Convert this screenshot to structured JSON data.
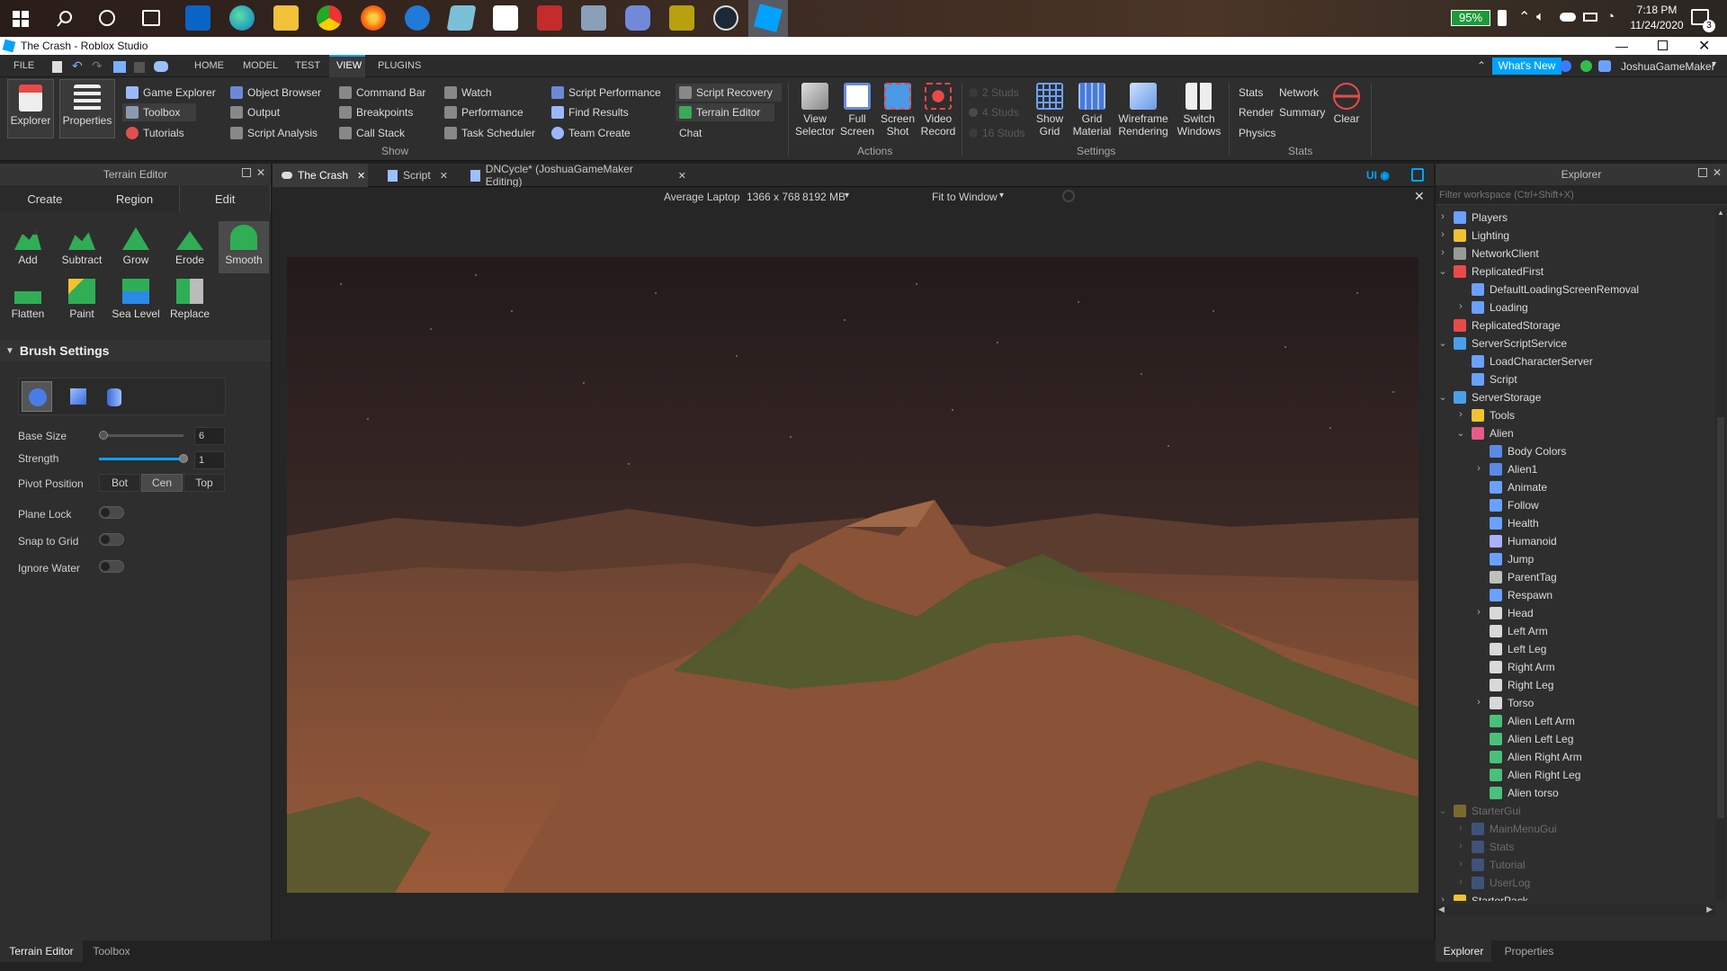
{
  "taskbar": {
    "battery": "95%",
    "time": "7:18 PM",
    "date": "11/24/2020",
    "notifications": "3"
  },
  "window": {
    "title": "The Crash - Roblox Studio",
    "user": "JoshuaGameMaker",
    "whats_new": "What's New"
  },
  "menubar": {
    "items": [
      "FILE",
      "HOME",
      "MODEL",
      "TEST",
      "VIEW",
      "PLUGINS"
    ]
  },
  "ribbon": {
    "explorer": "Explorer",
    "properties": "Properties",
    "show_col1": [
      "Game Explorer",
      "Toolbox",
      "Tutorials"
    ],
    "show_col2": [
      "Object Browser",
      "Output",
      "Script Analysis"
    ],
    "show_col3": [
      "Command Bar",
      "Breakpoints",
      "Call Stack"
    ],
    "show_col4": [
      "Watch",
      "Performance",
      "Task Scheduler"
    ],
    "show_col5": [
      "Script Performance",
      "Find Results",
      "Team Create"
    ],
    "show_col6": [
      "Script Recovery",
      "Terrain Editor",
      "Chat"
    ],
    "show_label": "Show",
    "actions": {
      "view_selector": [
        "View",
        "Selector"
      ],
      "full_screen": [
        "Full",
        "Screen"
      ],
      "screen_shot": [
        "Screen",
        "Shot"
      ],
      "video_record": [
        "Video",
        "Record"
      ],
      "label": "Actions"
    },
    "studs": [
      "2 Studs",
      "4 Studs",
      "16 Studs"
    ],
    "settings": {
      "show_grid": [
        "Show",
        "Grid"
      ],
      "grid_material": [
        "Grid",
        "Material"
      ],
      "wireframe": [
        "Wireframe",
        "Rendering"
      ],
      "switch_windows": [
        "Switch",
        "Windows"
      ],
      "label": "Settings"
    },
    "stats": {
      "col1": [
        "Stats",
        "Render",
        "Physics"
      ],
      "col2": [
        "Network",
        "Summary"
      ],
      "clear": "Clear",
      "label": "Stats"
    },
    "accent": "#00a2ff"
  },
  "terrain_editor": {
    "title": "Terrain Editor",
    "tabs": [
      "Create",
      "Region",
      "Edit"
    ],
    "tools_row1": [
      "Add",
      "Subtract",
      "Grow",
      "Erode",
      "Smooth"
    ],
    "tools_row2": [
      "Flatten",
      "Paint",
      "Sea Level",
      "Replace"
    ],
    "brush_settings": "Brush Settings",
    "base_size_label": "Base Size",
    "base_size_value": "6",
    "strength_label": "Strength",
    "strength_value": "1",
    "base_size_fraction": 0.05,
    "strength_fraction": 1.0,
    "pivot_label": "Pivot Position",
    "pivot_options": [
      "Bot",
      "Cen",
      "Top"
    ],
    "plane_lock": "Plane Lock",
    "snap_to_grid": "Snap to Grid",
    "ignore_water": "Ignore Water"
  },
  "doc_tabs": [
    "The Crash",
    "Script",
    "DNCycle* (JoshuaGameMaker Editing)"
  ],
  "emulator": {
    "device": "Average Laptop",
    "resolution": "1366 x 768",
    "memory": "8192 MB",
    "fit": "Fit to Window",
    "ui_label": "UI"
  },
  "explorer": {
    "title": "Explorer",
    "filter_placeholder": "Filter workspace (Ctrl+Shift+X)",
    "items": [
      {
        "label": "Players",
        "depth": 0,
        "chev": ">",
        "icon": "#6aa0ff"
      },
      {
        "label": "Lighting",
        "depth": 0,
        "chev": ">",
        "icon": "#f2c230"
      },
      {
        "label": "NetworkClient",
        "depth": 0,
        "chev": ">",
        "icon": "#9a9a9a"
      },
      {
        "label": "ReplicatedFirst",
        "depth": 0,
        "chev": "v",
        "icon": "#e84a4a"
      },
      {
        "label": "DefaultLoadingScreenRemoval",
        "depth": 1,
        "chev": "",
        "icon": "#6aa0ff"
      },
      {
        "label": "Loading",
        "depth": 1,
        "chev": ">",
        "icon": "#6aa0ff"
      },
      {
        "label": "ReplicatedStorage",
        "depth": 0,
        "chev": "",
        "icon": "#e84a4a"
      },
      {
        "label": "ServerScriptService",
        "depth": 0,
        "chev": "v",
        "icon": "#4aa0e8"
      },
      {
        "label": "LoadCharacterServer",
        "depth": 1,
        "chev": "",
        "icon": "#6aa0ff"
      },
      {
        "label": "Script",
        "depth": 1,
        "chev": "",
        "icon": "#6aa0ff"
      },
      {
        "label": "ServerStorage",
        "depth": 0,
        "chev": "v",
        "icon": "#4aa0e8"
      },
      {
        "label": "Tools",
        "depth": 1,
        "chev": ">",
        "icon": "#f2c230"
      },
      {
        "label": "Alien",
        "depth": 1,
        "chev": "v",
        "icon": "#e85a8a"
      },
      {
        "label": "Body Colors",
        "depth": 2,
        "chev": "",
        "icon": "#5a8ae8"
      },
      {
        "label": "Alien1",
        "depth": 2,
        "chev": ">",
        "icon": "#5a8ae8"
      },
      {
        "label": "Animate",
        "depth": 2,
        "chev": "",
        "icon": "#6aa0ff"
      },
      {
        "label": "Follow",
        "depth": 2,
        "chev": "",
        "icon": "#6aa0ff"
      },
      {
        "label": "Health",
        "depth": 2,
        "chev": "",
        "icon": "#6aa0ff"
      },
      {
        "label": "Humanoid",
        "depth": 2,
        "chev": "",
        "icon": "#aab0ff"
      },
      {
        "label": "Jump",
        "depth": 2,
        "chev": "",
        "icon": "#6aa0ff"
      },
      {
        "label": "ParentTag",
        "depth": 2,
        "chev": "",
        "icon": "#c0c0c0"
      },
      {
        "label": "Respawn",
        "depth": 2,
        "chev": "",
        "icon": "#6aa0ff"
      },
      {
        "label": "Head",
        "depth": 2,
        "chev": ">",
        "icon": "#d8d8d8"
      },
      {
        "label": "Left Arm",
        "depth": 2,
        "chev": "",
        "icon": "#d8d8d8"
      },
      {
        "label": "Left Leg",
        "depth": 2,
        "chev": "",
        "icon": "#d8d8d8"
      },
      {
        "label": "Right Arm",
        "depth": 2,
        "chev": "",
        "icon": "#d8d8d8"
      },
      {
        "label": "Right Leg",
        "depth": 2,
        "chev": "",
        "icon": "#d8d8d8"
      },
      {
        "label": "Torso",
        "depth": 2,
        "chev": ">",
        "icon": "#d8d8d8"
      },
      {
        "label": "Alien Left Arm",
        "depth": 2,
        "chev": "",
        "icon": "#4ac07a"
      },
      {
        "label": "Alien Left Leg",
        "depth": 2,
        "chev": "",
        "icon": "#4ac07a"
      },
      {
        "label": "Alien Right Arm",
        "depth": 2,
        "chev": "",
        "icon": "#4ac07a"
      },
      {
        "label": "Alien Right Leg",
        "depth": 2,
        "chev": "",
        "icon": "#4ac07a"
      },
      {
        "label": "Alien torso",
        "depth": 2,
        "chev": "",
        "icon": "#4ac07a"
      },
      {
        "label": "StarterGui",
        "depth": 0,
        "chev": "v",
        "icon": "#f2c230",
        "dim": true
      },
      {
        "label": "MainMenuGui",
        "depth": 1,
        "chev": ">",
        "icon": "#5a8ae8",
        "dim": true
      },
      {
        "label": "Stats",
        "depth": 1,
        "chev": ">",
        "icon": "#5a8ae8",
        "dim": true
      },
      {
        "label": "Tutorial",
        "depth": 1,
        "chev": ">",
        "icon": "#5a8ae8",
        "dim": true
      },
      {
        "label": "UserLog",
        "depth": 1,
        "chev": ">",
        "icon": "#5a8ae8",
        "dim": true
      },
      {
        "label": "StarterPack",
        "depth": 0,
        "chev": ">",
        "icon": "#f2c230"
      }
    ]
  },
  "bottom_tabs_left": [
    "Terrain Editor",
    "Toolbox"
  ],
  "bottom_tabs_right": [
    "Explorer",
    "Properties"
  ]
}
